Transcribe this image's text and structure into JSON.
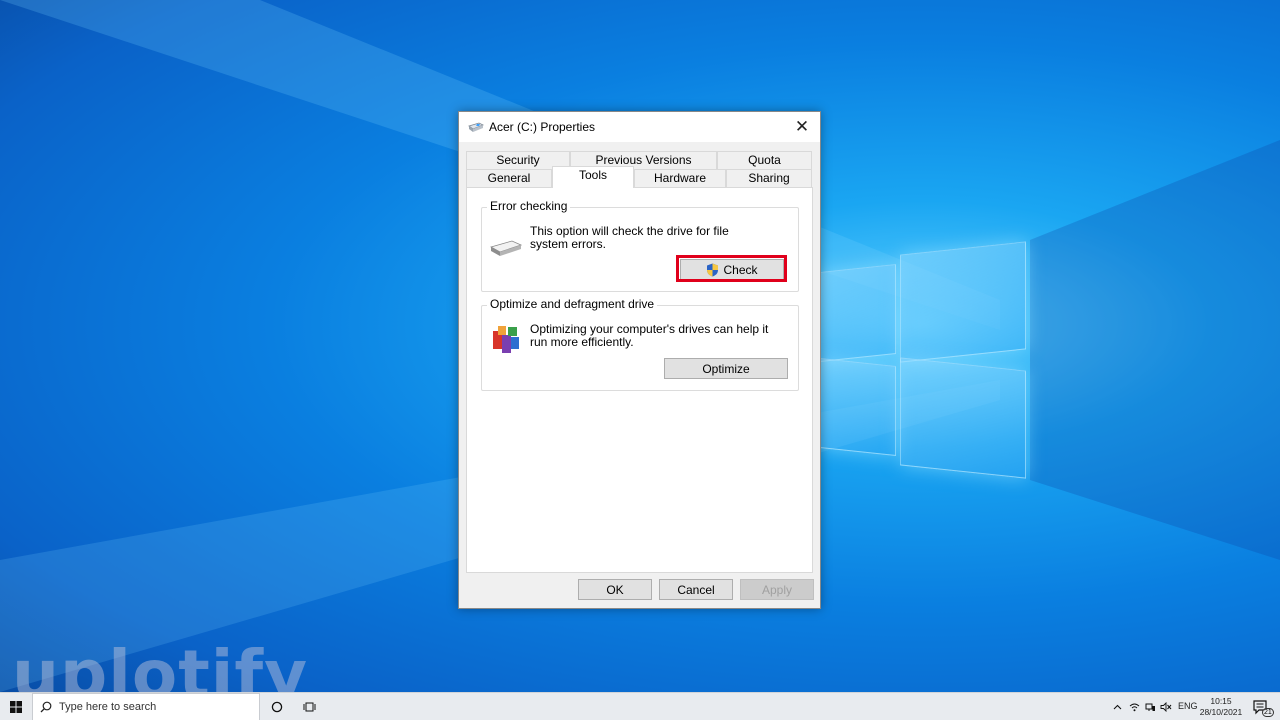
{
  "dialog": {
    "title": "Acer (C:) Properties",
    "close_glyph": "✕",
    "tabs_top_row": [
      "Security",
      "Previous Versions",
      "Quota"
    ],
    "tabs_bottom_row": [
      "General",
      "Tools",
      "Hardware",
      "Sharing"
    ],
    "active_tab": "Tools",
    "error_checking": {
      "legend": "Error checking",
      "description": "This option will check the drive for file system errors.",
      "button_label": "Check"
    },
    "optimize": {
      "legend": "Optimize and defragment drive",
      "description": "Optimizing your computer's drives can help it run more efficiently.",
      "button_label": "Optimize"
    },
    "footer": {
      "ok_label": "OK",
      "cancel_label": "Cancel",
      "apply_label": "Apply"
    }
  },
  "desktop": {
    "watermark_text": "uplotify"
  },
  "taskbar": {
    "search_placeholder": "Type here to search",
    "language": "ENG",
    "time": "10:15",
    "date": "28/10/2021",
    "notification_count": "21"
  },
  "colors": {
    "highlight": "#e0001b",
    "desktop_blue": "#0a7fe0"
  }
}
